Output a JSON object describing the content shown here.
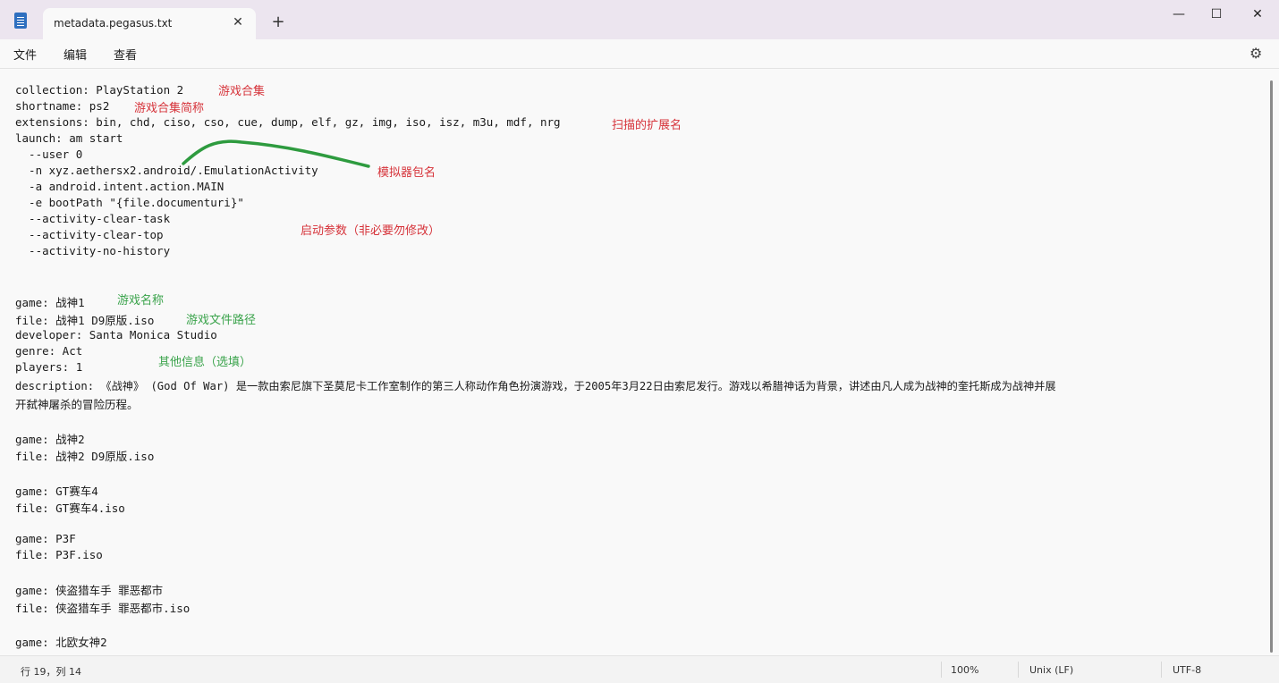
{
  "window": {
    "tab_title": "metadata.pegasus.txt",
    "close_tab": "✕",
    "new_tab": "+",
    "minimize": "—",
    "maximize": "☐",
    "close": "✕"
  },
  "menu": {
    "file": "文件",
    "edit": "编辑",
    "view": "查看",
    "settings_icon": "⚙"
  },
  "lines": [
    "collection: PlayStation 2",
    "shortname: ps2",
    "extensions: bin, chd, ciso, cso, cue, dump, elf, gz, img, iso, isz, m3u, mdf, nrg",
    "launch: am start",
    "  --user 0",
    "  -n xyz.aethersx2.android/.EmulationActivity",
    "  -a android.intent.action.MAIN",
    "  -e bootPath \"{file.documenturi}\"",
    "  --activity-clear-task",
    "  --activity-clear-top",
    "  --activity-no-history",
    "game: 战神1",
    "file: 战神1 D9原版.iso",
    "developer: Santa Monica Studio",
    "genre: Act",
    "players: 1",
    "description: 《战神》 (God Of War) 是一款由索尼旗下圣莫尼卡工作室制作的第三人称动作角色扮演游戏，于2005年3月22日由索尼发行。游戏以希腊神话为背景，讲述由凡人成为战神的奎托斯成为战神并展",
    "开弑神屠杀的冒险历程。",
    "game: 战神2",
    "file: 战神2 D9原版.iso",
    "game: GT赛车4",
    "file: GT赛车4.iso",
    "game: P3F",
    "file: P3F.iso",
    "game: 侠盗猎车手 罪恶都市",
    "file: 侠盗猎车手 罪恶都市.iso",
    "game: 北欧女神2"
  ],
  "notes": {
    "collection": "游戏合集",
    "shortname": "游戏合集简称",
    "extensions": "扫描的扩展名",
    "package": "模拟器包名",
    "launch_params": "启动参数（非必要勿修改）",
    "game_name": "游戏名称",
    "file_path": "游戏文件路径",
    "other_info": "其他信息（选填）"
  },
  "status": {
    "position": "行 19，列 14",
    "zoom": "100%",
    "line_ending": "Unix (LF)",
    "encoding": "UTF-8"
  },
  "colors": {
    "note_red": "#d6333a",
    "note_green": "#3aa34b",
    "stroke_green": "#2e9b3f"
  }
}
